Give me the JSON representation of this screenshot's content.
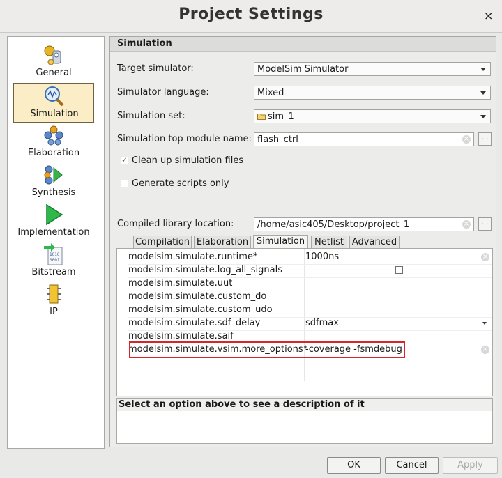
{
  "window": {
    "title": "Project Settings",
    "close_glyph": "×"
  },
  "nav": {
    "items": [
      {
        "label": "General",
        "icon": "general-icon",
        "selected": false
      },
      {
        "label": "Simulation",
        "icon": "simulation-icon",
        "selected": true
      },
      {
        "label": "Elaboration",
        "icon": "elaboration-icon",
        "selected": false
      },
      {
        "label": "Synthesis",
        "icon": "synthesis-icon",
        "selected": false
      },
      {
        "label": "Implementation",
        "icon": "implementation-icon",
        "selected": false
      },
      {
        "label": "Bitstream",
        "icon": "bitstream-icon",
        "selected": false
      },
      {
        "label": "IP",
        "icon": "ip-icon",
        "selected": false
      }
    ]
  },
  "section": {
    "title": "Simulation"
  },
  "fields": {
    "target_simulator": {
      "label": "Target simulator:",
      "value": "ModelSim Simulator"
    },
    "simulator_language": {
      "label": "Simulator language:",
      "value": "Mixed"
    },
    "simulation_set": {
      "label": "Simulation set:",
      "value": "sim_1"
    },
    "top_module": {
      "label": "Simulation top module name:",
      "value": "flash_ctrl"
    },
    "clean_up": {
      "label": "Clean up simulation files",
      "checked": true
    },
    "generate_scripts": {
      "label": "Generate scripts only",
      "checked": false
    },
    "compiled_library": {
      "label": "Compiled library location:",
      "value": "/home/asic405/Desktop/project_1"
    },
    "browse_label": "..."
  },
  "tabs": [
    {
      "label": "Compilation",
      "selected": false
    },
    {
      "label": "Elaboration",
      "selected": false
    },
    {
      "label": "Simulation",
      "selected": true
    },
    {
      "label": "Netlist",
      "selected": false
    },
    {
      "label": "Advanced",
      "selected": false
    }
  ],
  "properties": [
    {
      "key": "modelsim.simulate.runtime*",
      "value": "1000ns"
    },
    {
      "key": "modelsim.simulate.log_all_signals",
      "value": "",
      "checkbox": true
    },
    {
      "key": "modelsim.simulate.uut",
      "value": ""
    },
    {
      "key": "modelsim.simulate.custom_do",
      "value": ""
    },
    {
      "key": "modelsim.simulate.custom_udo",
      "value": ""
    },
    {
      "key": "modelsim.simulate.sdf_delay",
      "value": "sdfmax",
      "dropdown": true
    },
    {
      "key": "modelsim.simulate.saif",
      "value": ""
    },
    {
      "key": "modelsim.simulate.vsim.more_options*",
      "value": "-coverage -fsmdebug",
      "highlighted": true
    }
  ],
  "description": {
    "text": "Select an option above to see a description of it"
  },
  "buttons": {
    "ok": "OK",
    "cancel": "Cancel",
    "apply": "Apply"
  },
  "colors": {
    "selected_nav_bg": "#fbeec7",
    "highlight_border": "#d9252a"
  }
}
